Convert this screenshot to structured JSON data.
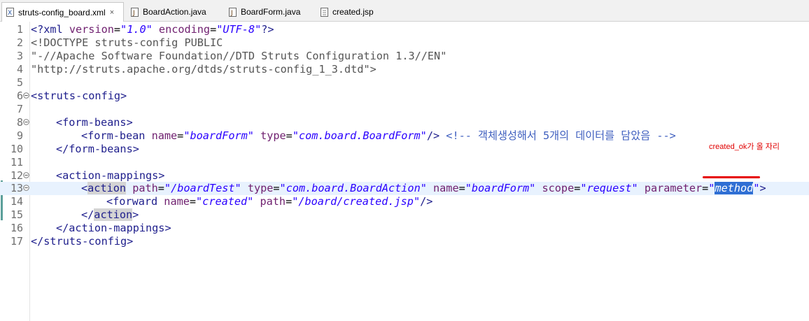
{
  "tabs": [
    {
      "label": "struts-config_board.xml",
      "icon": "xml-file-icon",
      "active": true,
      "close": "×"
    },
    {
      "label": "BoardAction.java",
      "icon": "java-file-icon",
      "active": false
    },
    {
      "label": "BoardForm.java",
      "icon": "java-file-icon",
      "active": false
    },
    {
      "label": "created.jsp",
      "icon": "jsp-file-icon",
      "active": false
    }
  ],
  "editor": {
    "line_numbers": [
      "1",
      "2",
      "3",
      "4",
      "5",
      "6",
      "7",
      "8",
      "9",
      "10",
      "11",
      "12",
      "13",
      "14",
      "15",
      "16",
      "17"
    ],
    "current_line": "13",
    "code": {
      "l1_open": "<?xml ",
      "l1_attr1": "version",
      "l1_val1": "\"1.0\"",
      "l1_attr2": "encoding",
      "l1_val2": "\"UTF-8\"",
      "l1_close": "?>",
      "l2": "<!DOCTYPE struts-config PUBLIC",
      "l3": "\"-//Apache Software Foundation//DTD Struts Configuration 1.3//EN\"",
      "l4": "\"http://struts.apache.org/dtds/struts-config_1_3.dtd\">",
      "l6": "<struts-config>",
      "l8": "<form-beans>",
      "l9_tag": "<form-bean ",
      "l9_name_attr": "name",
      "l9_name_val": "\"boardForm\"",
      "l9_type_attr": "type",
      "l9_type_val": "\"com.board.BoardForm\"",
      "l9_end": "/>",
      "l9_comment": "<!-- 객체생성해서 5개의 데이터를 담았음 -->",
      "l10": "</form-beans>",
      "l12": "<action-mappings>",
      "l13_lt": "<",
      "l13_tag": "action",
      "l13_path_attr": "path",
      "l13_path_val": "\"/boardTest\"",
      "l13_type_attr": "type",
      "l13_type_val": "\"com.board.BoardAction\"",
      "l13_name_attr": "name",
      "l13_name_val": "\"boardForm\"",
      "l13_scope_attr": "scope",
      "l13_scope_val": "\"request\"",
      "l13_param_attr": "parameter",
      "l13_param_q1": "\"",
      "l13_param_val": "method",
      "l13_param_q2": "\"",
      "l13_end": ">",
      "l14_tag": "<forward ",
      "l14_name_attr": "name",
      "l14_name_val": "\"created\"",
      "l14_path_attr": "path",
      "l14_path_val": "\"/board/created.jsp\"",
      "l14_end": "/>",
      "l15_open": "</",
      "l15_tag": "action",
      "l15_close": ">",
      "l16": "</action-mappings>",
      "l17": "</struts-config>"
    }
  },
  "annotation": {
    "text": "created_ok가 올 자리",
    "color": "#e00000"
  }
}
